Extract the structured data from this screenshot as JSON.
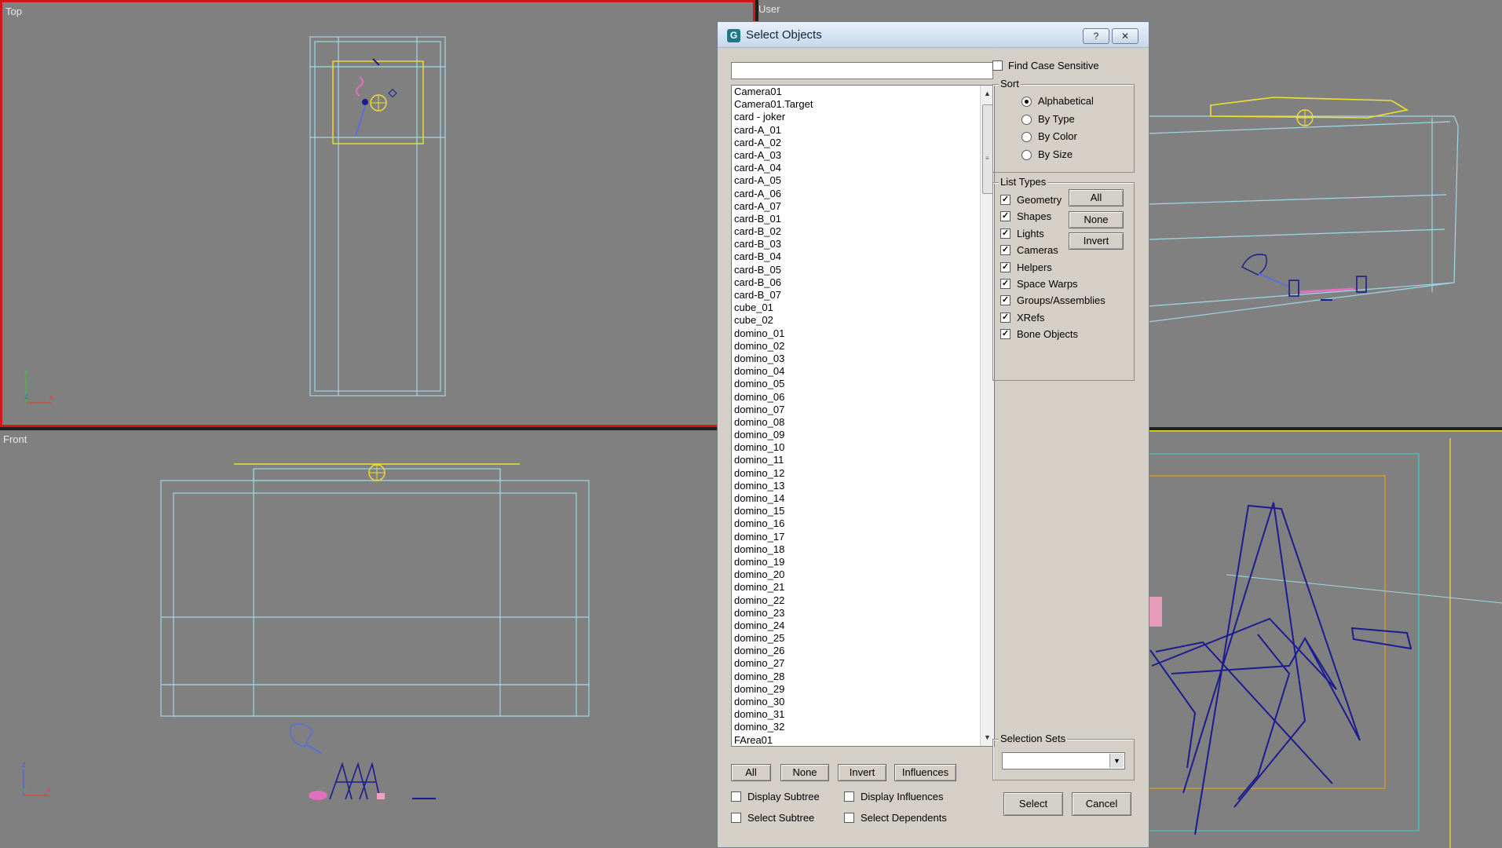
{
  "viewports": {
    "top": {
      "label": "Top"
    },
    "user": {
      "label": "User"
    },
    "front": {
      "label": "Front"
    },
    "camera": {
      "label": ""
    }
  },
  "colors": {
    "wire_cyan": "#9fd8e6",
    "selection_yellow": "#f0e030",
    "active_border": "#d01818",
    "card_blue": "#1c1c90",
    "pink": "#e070c0"
  },
  "dialog": {
    "title": "Select Objects",
    "help_button": "?",
    "close_button": "✕",
    "search_value": "",
    "objects": [
      "Camera01",
      "Camera01.Target",
      "card - joker",
      "card-A_01",
      "card-A_02",
      "card-A_03",
      "card-A_04",
      "card-A_05",
      "card-A_06",
      "card-A_07",
      "card-B_01",
      "card-B_02",
      "card-B_03",
      "card-B_04",
      "card-B_05",
      "card-B_06",
      "card-B_07",
      "cube_01",
      "cube_02",
      "domino_01",
      "domino_02",
      "domino_03",
      "domino_04",
      "domino_05",
      "domino_06",
      "domino_07",
      "domino_08",
      "domino_09",
      "domino_10",
      "domino_11",
      "domino_12",
      "domino_13",
      "domino_14",
      "domino_15",
      "domino_16",
      "domino_17",
      "domino_18",
      "domino_19",
      "domino_20",
      "domino_21",
      "domino_22",
      "domino_23",
      "domino_24",
      "domino_25",
      "domino_26",
      "domino_27",
      "domino_28",
      "domino_29",
      "domino_30",
      "domino_31",
      "domino_32",
      "FArea01"
    ],
    "find_case_sensitive": {
      "label": "Find Case Sensitive",
      "checked": false
    },
    "sort": {
      "title": "Sort",
      "options": [
        {
          "label": "Alphabetical",
          "selected": true
        },
        {
          "label": "By Type",
          "selected": false
        },
        {
          "label": "By Color",
          "selected": false
        },
        {
          "label": "By Size",
          "selected": false
        }
      ]
    },
    "list_types": {
      "title": "List Types",
      "items": [
        {
          "label": "Geometry",
          "checked": true
        },
        {
          "label": "Shapes",
          "checked": true
        },
        {
          "label": "Lights",
          "checked": true
        },
        {
          "label": "Cameras",
          "checked": true
        },
        {
          "label": "Helpers",
          "checked": true
        },
        {
          "label": "Space Warps",
          "checked": true
        },
        {
          "label": "Groups/Assemblies",
          "checked": true
        },
        {
          "label": "XRefs",
          "checked": true
        },
        {
          "label": "Bone Objects",
          "checked": true
        }
      ],
      "buttons": {
        "all": "All",
        "none": "None",
        "invert": "Invert"
      }
    },
    "bottom_buttons": {
      "all": "All",
      "none": "None",
      "invert": "Invert",
      "influences": "Influences"
    },
    "options": {
      "display_subtree": {
        "label": "Display Subtree",
        "checked": false
      },
      "select_subtree": {
        "label": "Select Subtree",
        "checked": false
      },
      "display_influences": {
        "label": "Display Influences",
        "checked": false
      },
      "select_dependents": {
        "label": "Select Dependents",
        "checked": false
      }
    },
    "selection_sets": {
      "title": "Selection Sets",
      "value": ""
    },
    "select_button": "Select",
    "cancel_button": "Cancel"
  }
}
